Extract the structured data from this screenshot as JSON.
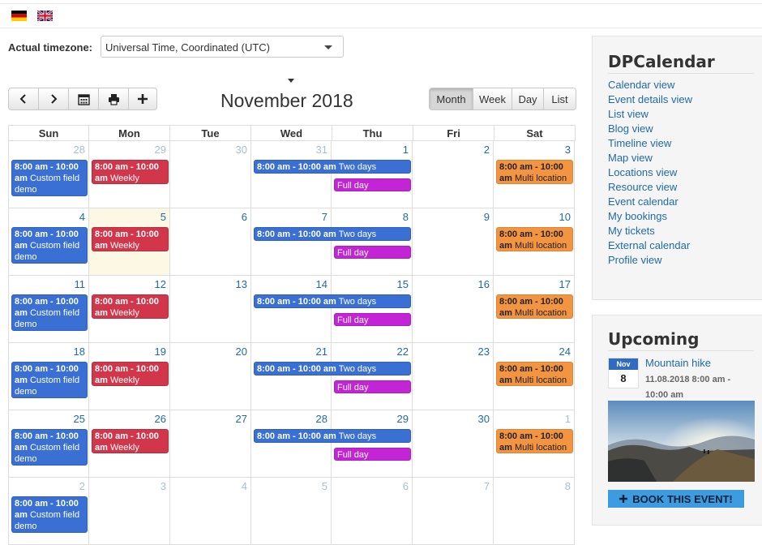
{
  "languages": [
    {
      "name": "German"
    },
    {
      "name": "English"
    }
  ],
  "timezone": {
    "label": "Actual timezone:",
    "value": "Universal Time, Coordinated (UTC)"
  },
  "toolbar": {
    "icons": [
      "chevron-left-icon",
      "chevron-right-icon",
      "calendar-icon",
      "print-icon",
      "plus-icon"
    ]
  },
  "calendar": {
    "title": "November 2018",
    "views": [
      "Month",
      "Week",
      "Day",
      "List"
    ],
    "active_view": "Month",
    "weekdays": [
      "Sun",
      "Mon",
      "Tue",
      "Wed",
      "Thu",
      "Fri",
      "Sat"
    ],
    "weeks": [
      [
        "28",
        "29",
        "30",
        "31",
        "1",
        "2",
        "3"
      ],
      [
        "4",
        "5",
        "6",
        "7",
        "8",
        "9",
        "10"
      ],
      [
        "11",
        "12",
        "13",
        "14",
        "15",
        "16",
        "17"
      ],
      [
        "18",
        "19",
        "20",
        "21",
        "22",
        "23",
        "24"
      ],
      [
        "25",
        "26",
        "27",
        "28",
        "29",
        "30",
        "1"
      ],
      [
        "2",
        "3",
        "4",
        "5",
        "6",
        "7",
        "8"
      ]
    ],
    "events": {
      "custom": {
        "time": "8:00 am - 10:00 am",
        "title": "Custom field demo",
        "color": "#3a6fd3"
      },
      "weekly": {
        "time": "8:00 am - 10:00 am",
        "title": "Weekly",
        "color": "#d2364a"
      },
      "twodays": {
        "time": "8:00 am - 10:00 am",
        "title": "Two days",
        "color": "#3a6fd3"
      },
      "fullday": {
        "title": "Full day",
        "color": "#c224d6"
      },
      "multi": {
        "time": "8:00 am - 10:00 am",
        "title": "Multi location",
        "color": "#f39440"
      }
    }
  },
  "sidebar": {
    "dpcalendar": {
      "title": "DPCalendar",
      "links": [
        "Calendar view",
        "Event details view",
        "List view",
        "Blog view",
        "Timeline view",
        "Map view",
        "Locations view",
        "Resource view",
        "Event calendar",
        "My bookings",
        "My tickets",
        "External calendar",
        "Profile view"
      ]
    },
    "upcoming": {
      "title": "Upcoming",
      "month": "Nov",
      "day": "8",
      "event_title": "Mountain hike",
      "event_date": "11.08.2018 8:00 am - 10:00 am",
      "book_label": "BOOK THIS EVENT!"
    }
  }
}
